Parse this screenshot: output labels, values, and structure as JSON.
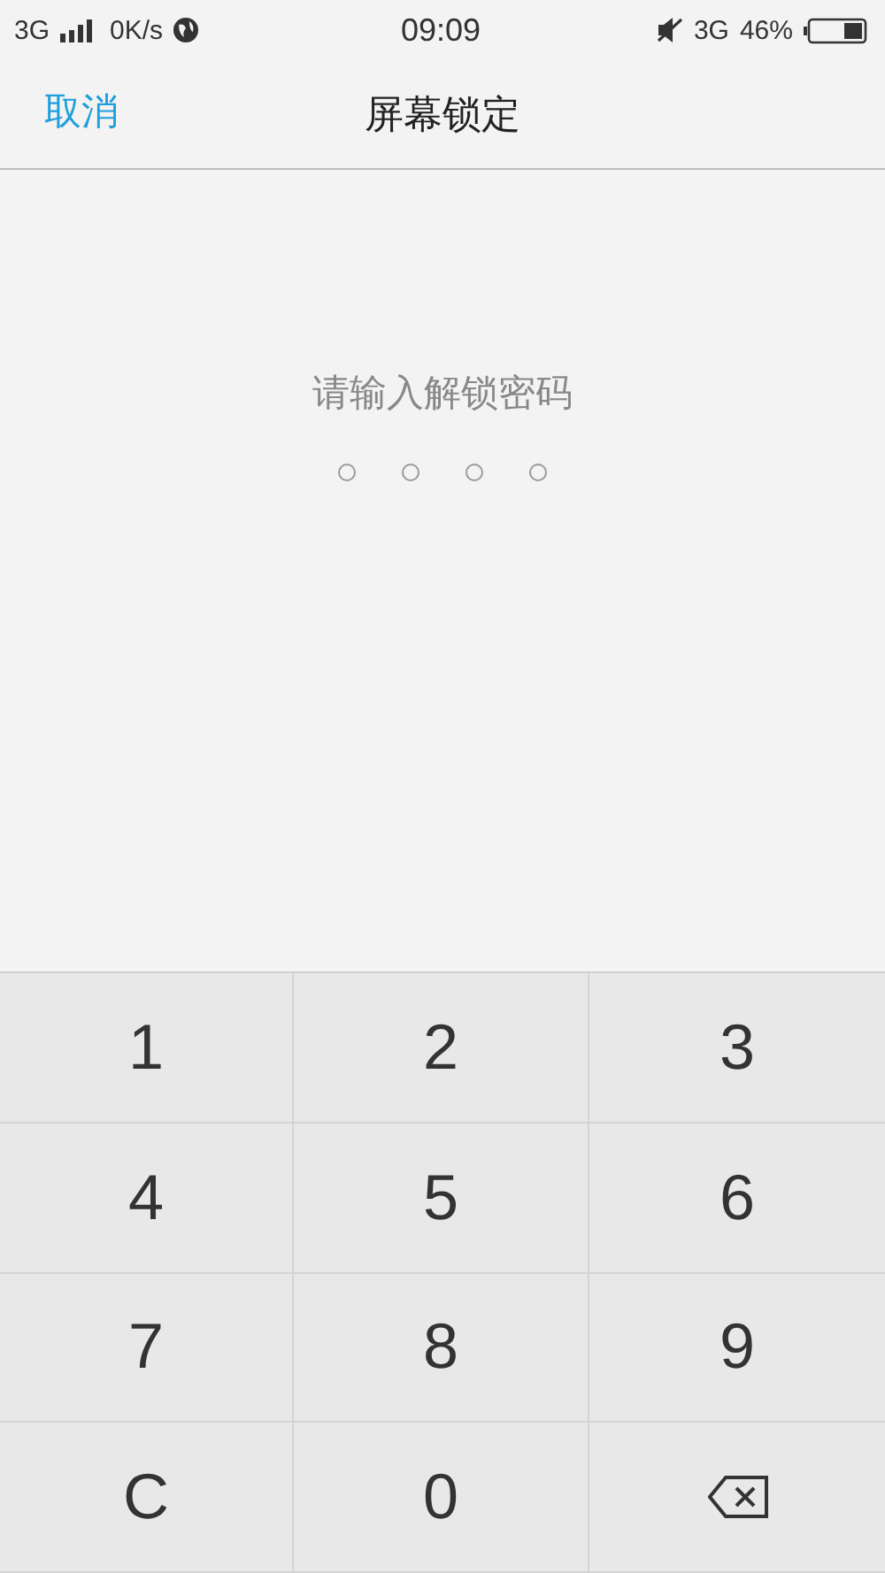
{
  "status_bar": {
    "network": "3G",
    "speed": "0K/s",
    "time": "09:09",
    "network_right": "3G",
    "battery": "46%"
  },
  "header": {
    "cancel": "取消",
    "title": "屏幕锁定"
  },
  "prompt": "请输入解锁密码",
  "pin_dots": [
    {
      "filled": false
    },
    {
      "filled": false
    },
    {
      "filled": false
    },
    {
      "filled": false
    }
  ],
  "keypad": [
    {
      "kind": "digit",
      "label": "1"
    },
    {
      "kind": "digit",
      "label": "2"
    },
    {
      "kind": "digit",
      "label": "3"
    },
    {
      "kind": "digit",
      "label": "4"
    },
    {
      "kind": "digit",
      "label": "5"
    },
    {
      "kind": "digit",
      "label": "6"
    },
    {
      "kind": "digit",
      "label": "7"
    },
    {
      "kind": "digit",
      "label": "8"
    },
    {
      "kind": "digit",
      "label": "9"
    },
    {
      "kind": "digit",
      "label": "C"
    },
    {
      "kind": "digit",
      "label": "0"
    },
    {
      "kind": "delete"
    }
  ]
}
